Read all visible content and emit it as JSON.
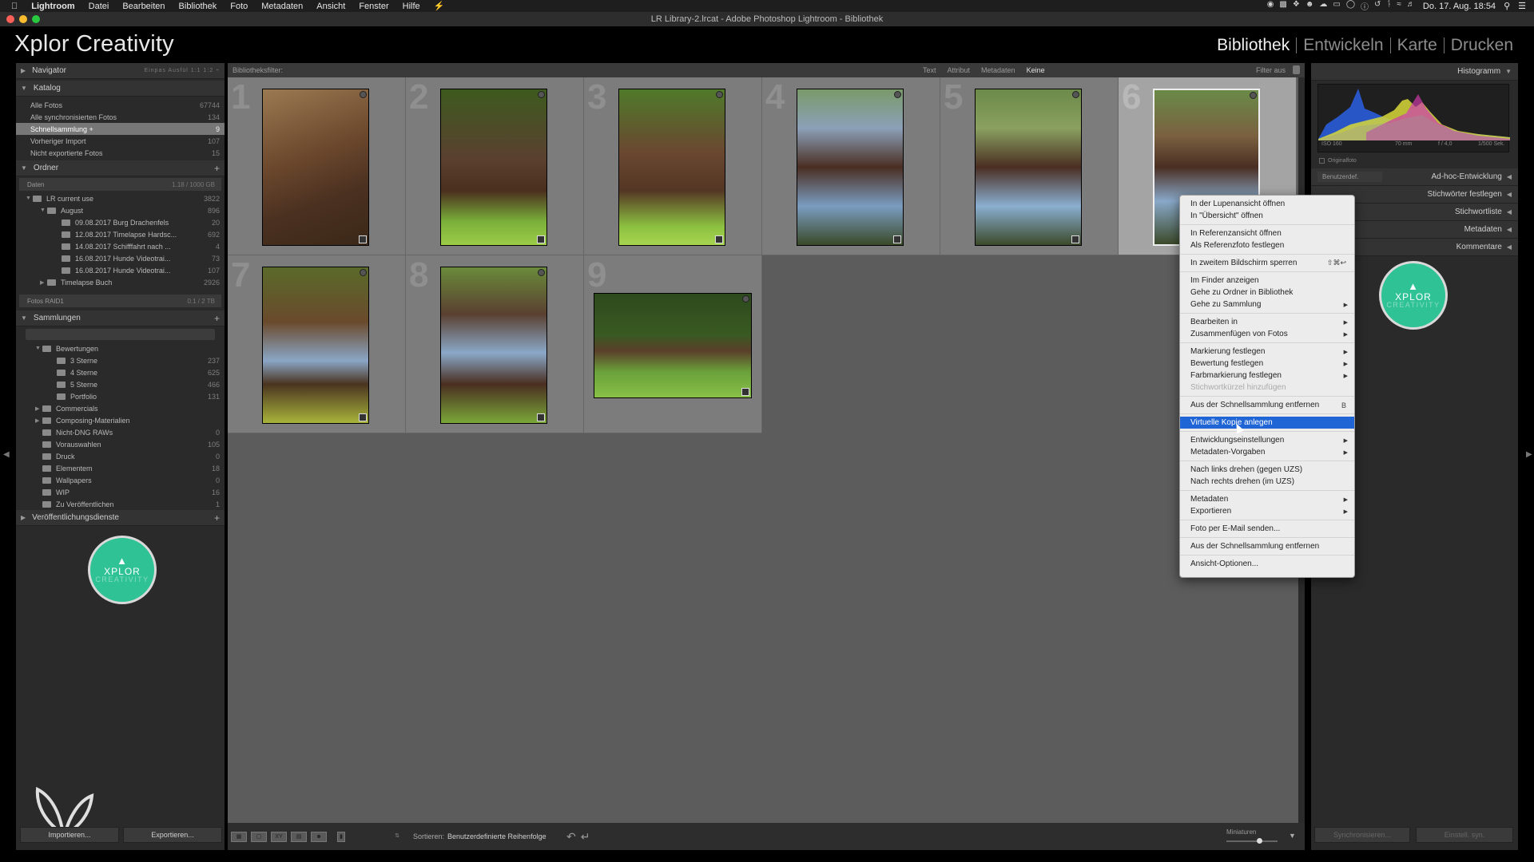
{
  "menubar": {
    "app": "Lightroom",
    "items": [
      "Datei",
      "Bearbeiten",
      "Bibliothek",
      "Foto",
      "Metadaten",
      "Ansicht",
      "Fenster",
      "Hilfe"
    ],
    "clock": "Do. 17. Aug. 18:54"
  },
  "window": {
    "title": "LR Library-2.lrcat - Adobe Photoshop Lightroom - Bibliothek"
  },
  "identity": {
    "logo": "Xplor Creativity"
  },
  "modules": [
    "Bibliothek",
    "Entwickeln",
    "Karte",
    "Drucken"
  ],
  "left": {
    "navigator": {
      "title": "Navigator",
      "zoom_options": "Einpas  Ausfül  1:1  1:2 ÷"
    },
    "catalog": {
      "title": "Katalog",
      "items": [
        {
          "label": "Alle Fotos",
          "count": "67744"
        },
        {
          "label": "Alle synchronisierten Fotos",
          "count": "134"
        },
        {
          "label": "Schnellsammlung +",
          "count": "9"
        },
        {
          "label": "Vorheriger Import",
          "count": "107"
        },
        {
          "label": "Nicht exportierte Fotos",
          "count": "15"
        }
      ]
    },
    "folders": {
      "title": "Ordner",
      "volume1": {
        "label": "Daten",
        "count": "1.18 / 1000 GB"
      },
      "items": [
        {
          "label": "LR current use",
          "count": "3822"
        },
        {
          "label": "August",
          "count": "896"
        },
        {
          "label": "09.08.2017 Burg Drachenfels",
          "count": "20"
        },
        {
          "label": "12.08.2017 Timelapse Hardsc...",
          "count": "692"
        },
        {
          "label": "14.08.2017 Schifffahrt nach ...",
          "count": "4"
        },
        {
          "label": "16.08.2017 Hunde Videotrai...",
          "count": "73"
        },
        {
          "label": "16.08.2017 Hunde Videotrai...",
          "count": "107"
        },
        {
          "label": "Timelapse Buch",
          "count": "2926"
        }
      ],
      "volume2": {
        "label": "Fotos RAID1",
        "count": "0.1 / 2 TB"
      }
    },
    "collections": {
      "title": "Sammlungen",
      "items": [
        {
          "label": "Bewertungen",
          "count": ""
        },
        {
          "label": "3 Sterne",
          "count": "237"
        },
        {
          "label": "4 Sterne",
          "count": "625"
        },
        {
          "label": "5 Sterne",
          "count": "466"
        },
        {
          "label": "Portfolio",
          "count": "131"
        },
        {
          "label": "Commercials",
          "count": ""
        },
        {
          "label": "Composing-Materialien",
          "count": ""
        },
        {
          "label": "Nicht-DNG RAWs",
          "count": "0"
        },
        {
          "label": "Vorauswahlen",
          "count": "105"
        },
        {
          "label": "Druck",
          "count": "0"
        },
        {
          "label": "Elementem",
          "count": "18"
        },
        {
          "label": "Wallpapers",
          "count": "0"
        },
        {
          "label": "WIP",
          "count": "16"
        },
        {
          "label": "Zu Veröffentlichen",
          "count": "1"
        }
      ]
    },
    "publish": {
      "title": "Veröffentlichungsdienste"
    },
    "badge": {
      "line1": "XPLOR",
      "line2": "CREATIVITY"
    },
    "import_label": "Importieren...",
    "export_label": "Exportieren..."
  },
  "filterbar": {
    "label": "Bibliotheksfilter:",
    "options": [
      "Text",
      "Attribut",
      "Metadaten",
      "Keine"
    ],
    "active": "Keine",
    "filter_off": "Filter aus"
  },
  "grid": {
    "cells": [
      {
        "num": "1"
      },
      {
        "num": "2"
      },
      {
        "num": "3"
      },
      {
        "num": "4"
      },
      {
        "num": "5"
      },
      {
        "num": "6"
      },
      {
        "num": "7"
      },
      {
        "num": "8"
      },
      {
        "num": "9"
      }
    ]
  },
  "toolbar": {
    "sort_label": "Sortieren:",
    "sort_value": "Benutzerdefinierte Reihenfolge",
    "thumbs_label": "Miniaturen"
  },
  "right": {
    "histogram": {
      "title": "Histogramm",
      "iso": "ISO 160",
      "focal": "70 mm",
      "aperture": "f / 4,0",
      "shutter": "1/500 Sek.",
      "original": "Originalfoto"
    },
    "quick_develop": {
      "preset": "Benutzerdef.",
      "title": "Ad-hoc-Entwicklung"
    },
    "panels": [
      "Stichwörter festlegen",
      "Stichwortliste",
      "Metadaten",
      "Kommentare"
    ],
    "badge": {
      "line1": "XPLOR",
      "line2": "CREATIVITY"
    },
    "sync_label": "Synchronisieren...",
    "sync_settings_label": "Einstell. syn."
  },
  "context_menu": {
    "groups": [
      [
        {
          "label": "In der Lupenansicht öffnen"
        },
        {
          "label": "In \"Übersicht\" öffnen"
        }
      ],
      [
        {
          "label": "In Referenzansicht öffnen"
        },
        {
          "label": "Als Referenzfoto festlegen"
        }
      ],
      [
        {
          "label": "In zweitem Bildschirm sperren",
          "shortcut": "⇧⌘↩"
        }
      ],
      [
        {
          "label": "Im Finder anzeigen"
        },
        {
          "label": "Gehe zu Ordner in Bibliothek"
        },
        {
          "label": "Gehe zu Sammlung",
          "submenu": true
        }
      ],
      [
        {
          "label": "Bearbeiten in",
          "submenu": true
        },
        {
          "label": "Zusammenfügen von Fotos",
          "submenu": true
        }
      ],
      [
        {
          "label": "Markierung festlegen",
          "submenu": true
        },
        {
          "label": "Bewertung festlegen",
          "submenu": true
        },
        {
          "label": "Farbmarkierung festlegen",
          "submenu": true
        },
        {
          "label": "Stichwortkürzel hinzufügen",
          "disabled": true
        }
      ],
      [
        {
          "label": "Aus der Schnellsammlung entfernen",
          "shortcut": "B"
        }
      ],
      [
        {
          "label": "Virtuelle Kopie anlegen",
          "highlighted": true
        }
      ],
      [
        {
          "label": "Entwicklungseinstellungen",
          "submenu": true
        },
        {
          "label": "Metadaten-Vorgaben",
          "submenu": true
        }
      ],
      [
        {
          "label": "Nach links drehen (gegen UZS)"
        },
        {
          "label": "Nach rechts drehen (im UZS)"
        }
      ],
      [
        {
          "label": "Metadaten",
          "submenu": true
        },
        {
          "label": "Exportieren",
          "submenu": true
        }
      ],
      [
        {
          "label": "Foto per E-Mail senden..."
        }
      ],
      [
        {
          "label": "Aus der Schnellsammlung entfernen"
        }
      ],
      [
        {
          "label": "Ansicht-Optionen..."
        }
      ]
    ]
  },
  "colors": {
    "accent_blue": "#1f65d6",
    "badge_green": "#2ec295",
    "panel_bg": "#2a2a2a",
    "grid_bg": "#5c5c5c"
  }
}
